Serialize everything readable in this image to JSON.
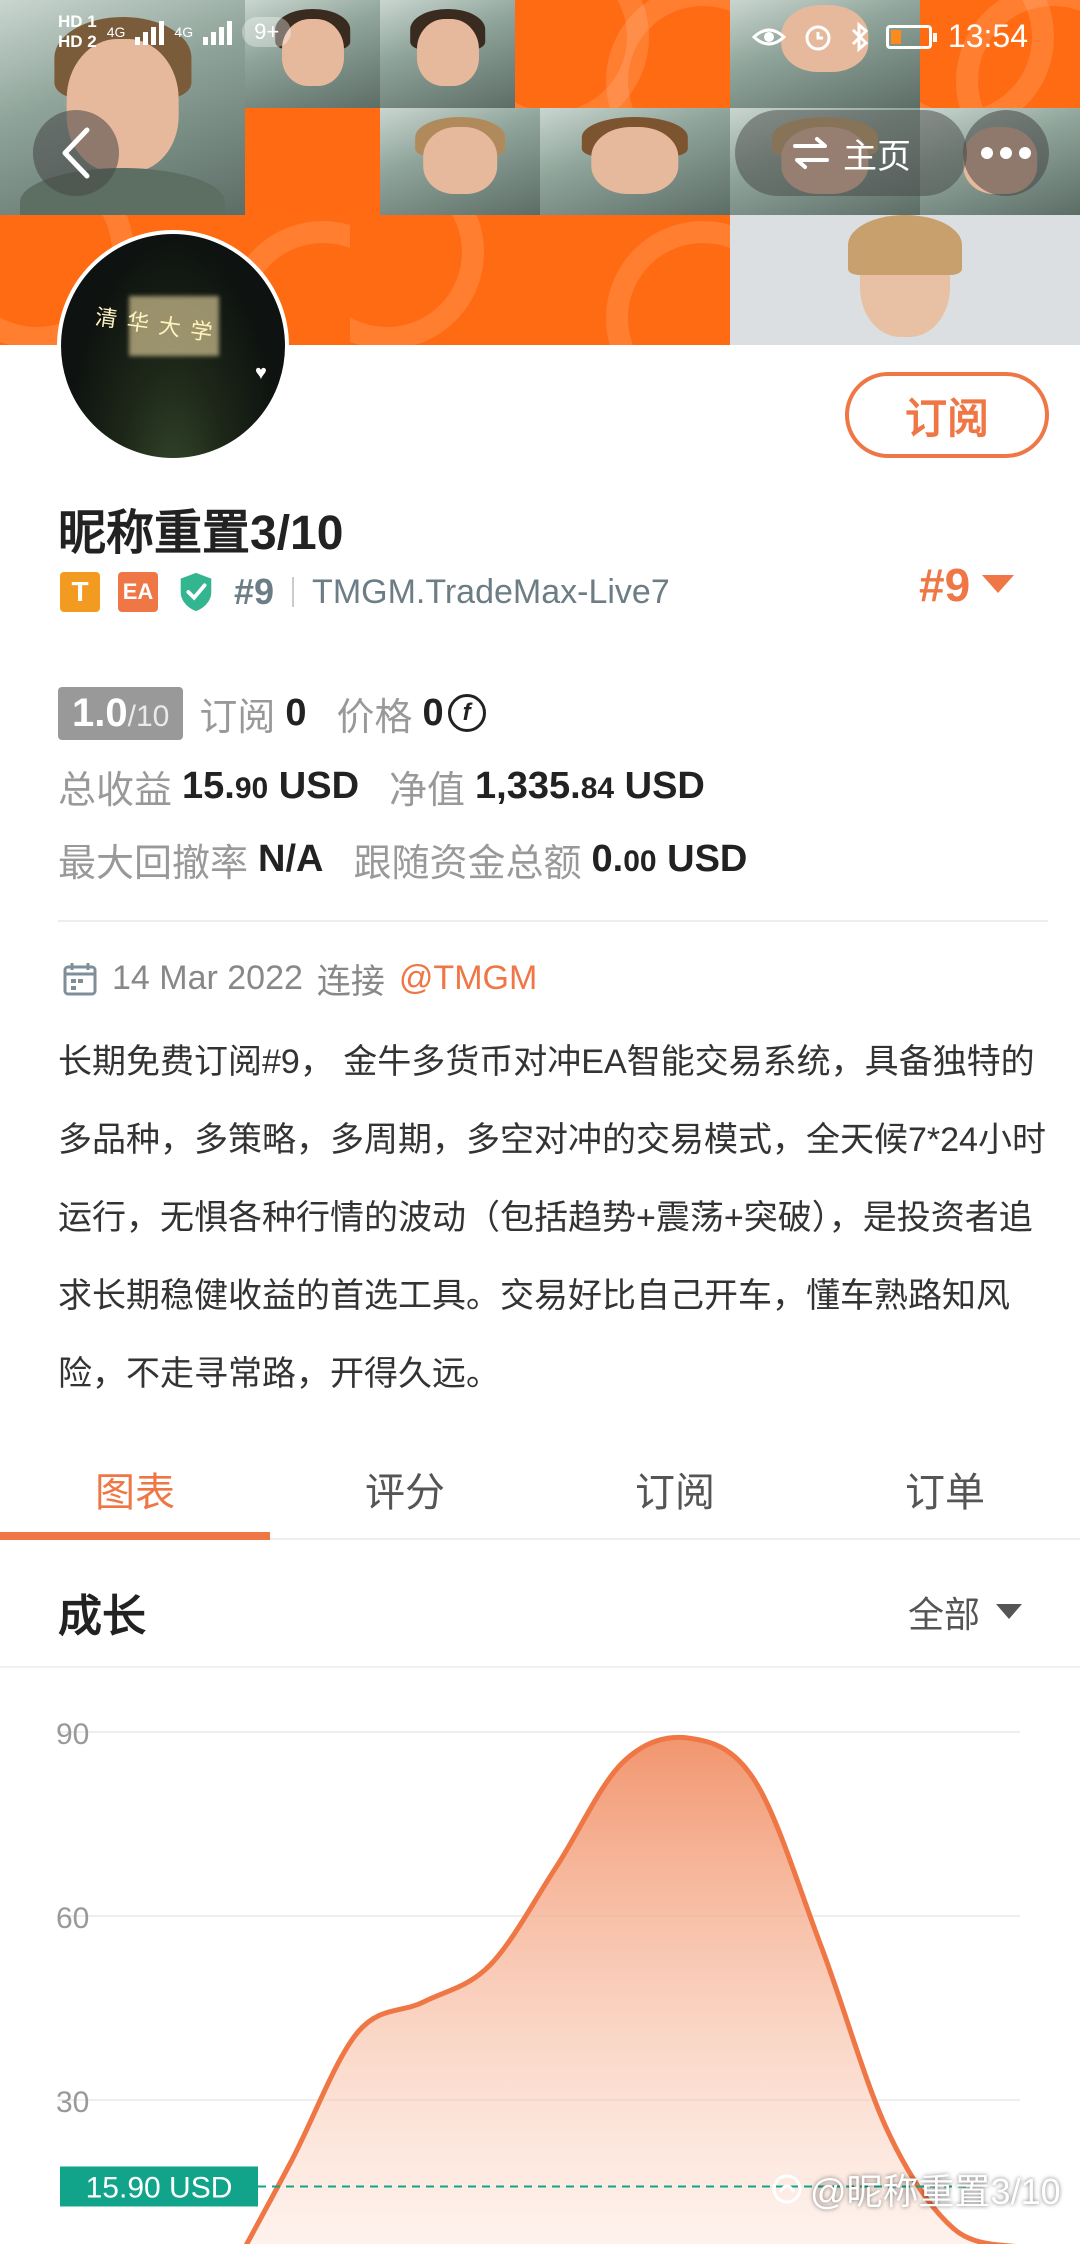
{
  "status_bar": {
    "hd1": "HD 1",
    "hd2": "HD 2",
    "net1": "4G",
    "net2": "4G",
    "notification_count": "9+",
    "time": "13:54"
  },
  "header": {
    "home_label": "主页"
  },
  "profile": {
    "subscribe_label": "订阅",
    "nickname": "昵称重置3/10",
    "tag_t": "T",
    "tag_ea": "EA",
    "rank_small": "#9",
    "server": "TMGM.TradeMax-Live7",
    "rank_big": "#9"
  },
  "stats": {
    "score": "1.0",
    "score_max": "/10",
    "subscribers_label": "订阅",
    "subscribers_value": "0",
    "price_label": "价格",
    "price_value": "0",
    "coin_symbol": "f",
    "total_profit_label": "总收益",
    "total_profit_int": "15.",
    "total_profit_dec": "90",
    "total_profit_unit": "USD",
    "equity_label": "净值",
    "equity_int": "1,335.",
    "equity_dec": "84",
    "equity_unit": "USD",
    "max_drawdown_label": "最大回撤率",
    "max_drawdown_value": "N/A",
    "follow_funds_label": "跟随资金总额",
    "follow_funds_int": "0.",
    "follow_funds_dec": "00",
    "follow_funds_unit": "USD"
  },
  "connection": {
    "date": "14 Mar 2022",
    "connect_label": "连接",
    "broker": "@TMGM"
  },
  "description": "长期免费订阅#9， 金牛多货币对冲EA智能交易系统，具备独特的多品种，多策略，多周期，多空对冲的交易模式，全天候7*24小时运行，无惧各种行情的波动（包括趋势+震荡+突破），是投资者追求长期稳健收益的首选工具。交易好比自己开车，懂车熟路知风险，不走寻常路，开得久远。",
  "tabs": [
    {
      "label": "图表",
      "active": true
    },
    {
      "label": "评分",
      "active": false
    },
    {
      "label": "订阅",
      "active": false
    },
    {
      "label": "订单",
      "active": false
    }
  ],
  "growth": {
    "title": "成长",
    "range_label": "全部"
  },
  "chart_data": {
    "type": "area",
    "title": "成长",
    "y_ticks": [
      90,
      60,
      30
    ],
    "ylim": [
      0,
      100
    ],
    "x": [
      0,
      1,
      2,
      3,
      4,
      5,
      6,
      7,
      8,
      9,
      10,
      11,
      12
    ],
    "values": [
      0,
      20,
      41,
      46,
      52,
      68,
      85,
      89,
      82,
      55,
      25,
      9,
      6
    ],
    "current_value": 15.9,
    "current_label": "15.90 USD",
    "grid": true,
    "line_color": "#ef7745"
  },
  "watermark": "@昵称重置3/10",
  "colors": {
    "accent": "#ef7745",
    "header_orange": "#ff6a13",
    "teal": "#12a48a"
  }
}
